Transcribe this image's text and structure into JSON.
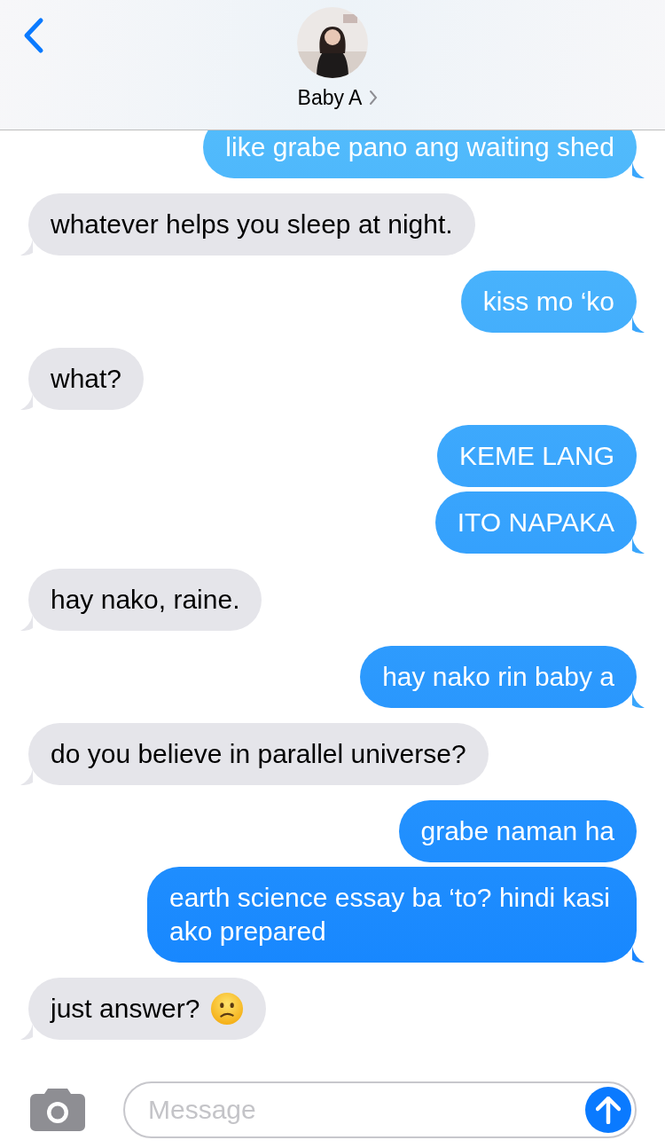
{
  "header": {
    "contact_name": "Baby A"
  },
  "messages": [
    {
      "kind": "sent",
      "text": "like grabe pano ang waiting shed"
    },
    {
      "kind": "received",
      "text": "whatever helps you sleep at night."
    },
    {
      "kind": "sent",
      "text": "kiss mo ‘ko"
    },
    {
      "kind": "received",
      "text": "what?"
    },
    {
      "kind": "sent",
      "text": "KEME LANG"
    },
    {
      "kind": "sent",
      "text": "ITO NAPAKA"
    },
    {
      "kind": "received",
      "text": "hay nako, raine."
    },
    {
      "kind": "sent",
      "text": "hay nako rin baby a"
    },
    {
      "kind": "received",
      "text": "do you believe in parallel universe?"
    },
    {
      "kind": "sent",
      "text": "grabe naman ha"
    },
    {
      "kind": "sent",
      "text": "earth science essay ba ‘to? hindi kasi ako prepared"
    },
    {
      "kind": "received",
      "text": "just answer?",
      "emoji_icon": true
    }
  ],
  "composer": {
    "placeholder": "Message"
  }
}
